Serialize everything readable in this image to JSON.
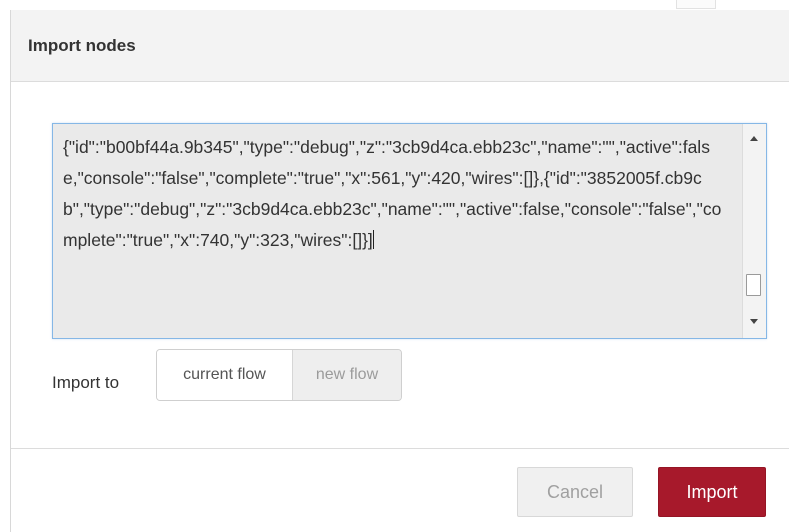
{
  "dialog": {
    "title": "Import nodes",
    "code_text": "{\"id\":\"b00bf44a.9b345\",\"type\":\"debug\",\"z\":\"3cb9d4ca.ebb23c\",\"name\":\"\",\"active\":false,\"console\":\"false\",\"complete\":\"true\",\"x\":561,\"y\":420,\"wires\":[]},{\"id\":\"3852005f.cb9cb\",\"type\":\"debug\",\"z\":\"3cb9d4ca.ebb23c\",\"name\":\"\",\"active\":false,\"console\":\"false\",\"complete\":\"true\",\"x\":740,\"y\":323,\"wires\":[]}]",
    "import_to_label": "Import to",
    "import_to_options": [
      {
        "label": "current flow",
        "selected": true
      },
      {
        "label": "new flow",
        "selected": false
      }
    ],
    "cancel_label": "Cancel",
    "import_label": "Import"
  },
  "icons": {
    "scroll_up": "triangle-up",
    "scroll_down": "triangle-down"
  },
  "colors": {
    "header_bg": "#f3f3f3",
    "textarea_bg": "#eaeaea",
    "textarea_border": "#85b7e6",
    "primary_button": "#a7192b",
    "selected_toggle_bg": "#ffffff",
    "unselected_toggle_bg": "#eeeeee"
  }
}
